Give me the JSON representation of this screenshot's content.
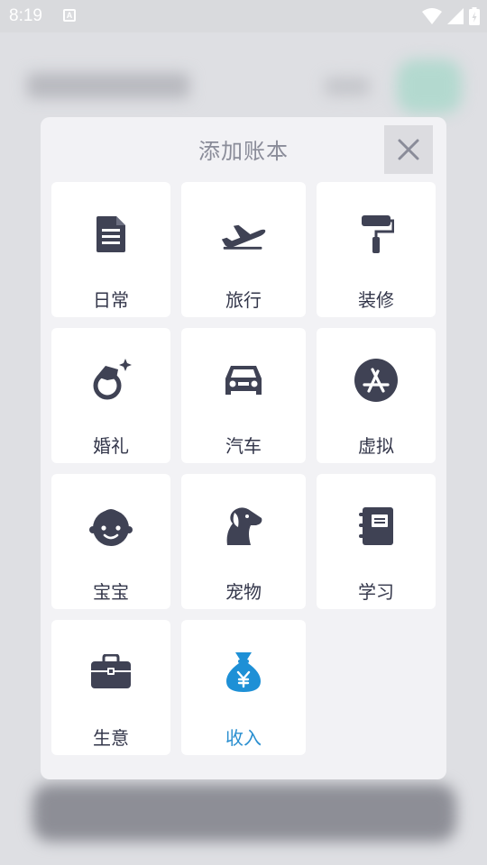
{
  "status_bar": {
    "time": "8:19",
    "a_badge": "A"
  },
  "dialog": {
    "title": "添加账本",
    "close_icon": "close-icon",
    "items": [
      {
        "label": "日常",
        "icon": "document-icon"
      },
      {
        "label": "旅行",
        "icon": "airplane-icon"
      },
      {
        "label": "装修",
        "icon": "paint-roller-icon"
      },
      {
        "label": "婚礼",
        "icon": "ring-icon"
      },
      {
        "label": "汽车",
        "icon": "car-icon"
      },
      {
        "label": "虚拟",
        "icon": "app-store-icon"
      },
      {
        "label": "宝宝",
        "icon": "baby-face-icon"
      },
      {
        "label": "宠物",
        "icon": "dog-icon"
      },
      {
        "label": "学习",
        "icon": "notebook-icon"
      },
      {
        "label": "生意",
        "icon": "briefcase-icon"
      },
      {
        "label": "收入",
        "icon": "money-bag-icon"
      }
    ]
  },
  "colors": {
    "icon": "#3f4254",
    "accent": "#1e90d6",
    "title": "#8a8c99"
  }
}
